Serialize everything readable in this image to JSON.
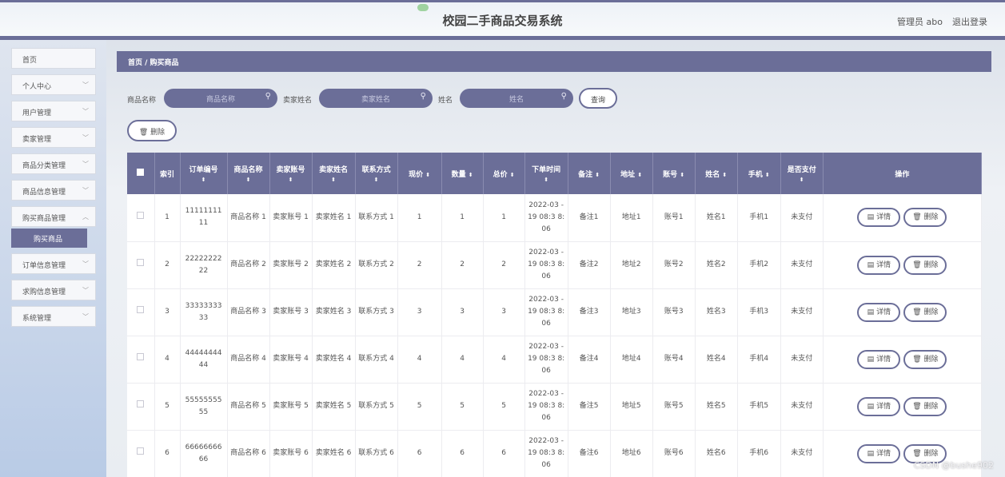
{
  "header": {
    "title": "校园二手商品交易系统",
    "user": "管理员 abo",
    "logout": "退出登录"
  },
  "sidebar": {
    "items": [
      {
        "label": "首页"
      },
      {
        "label": "个人中心"
      },
      {
        "label": "用户管理"
      },
      {
        "label": "卖家管理"
      },
      {
        "label": "商品分类管理"
      },
      {
        "label": "商品信息管理"
      },
      {
        "label": "购买商品管理"
      },
      {
        "label": "订单信息管理"
      },
      {
        "label": "求购信息管理"
      },
      {
        "label": "系统管理"
      }
    ],
    "active_sub": "购买商品"
  },
  "breadcrumb": {
    "text": "首页 / 购买商品"
  },
  "search": {
    "field1_label": "商品名称",
    "field1_placeholder": "商品名称",
    "field2_label": "卖家姓名",
    "field2_placeholder": "卖家姓名",
    "field3_label": "姓名",
    "field3_placeholder": "姓名",
    "query_label": "查询"
  },
  "toolbar": {
    "delete_label": "删除"
  },
  "table": {
    "headers": [
      "索引",
      "订单编号",
      "商品名称",
      "卖家账号",
      "卖家姓名",
      "联系方式",
      "现价",
      "数量",
      "总价",
      "下单时间",
      "备注",
      "地址",
      "账号",
      "姓名",
      "手机",
      "是否支付",
      "操作"
    ],
    "detail_label": "详情",
    "delete_label": "删除",
    "rows": [
      {
        "idx": "1",
        "order": "11111111 11",
        "goods": "商品名称 1",
        "seller_acc": "卖家账号 1",
        "seller_name": "卖家姓名 1",
        "contact": "联系方式 1",
        "price": "1",
        "qty": "1",
        "total": "1",
        "time": "2022-03 -19 08:3 8:06",
        "note": "备注1",
        "addr": "地址1",
        "acc": "账号1",
        "name": "姓名1",
        "phone": "手机1",
        "paid": "未支付"
      },
      {
        "idx": "2",
        "order": "22222222 22",
        "goods": "商品名称 2",
        "seller_acc": "卖家账号 2",
        "seller_name": "卖家姓名 2",
        "contact": "联系方式 2",
        "price": "2",
        "qty": "2",
        "total": "2",
        "time": "2022-03 -19 08:3 8:06",
        "note": "备注2",
        "addr": "地址2",
        "acc": "账号2",
        "name": "姓名2",
        "phone": "手机2",
        "paid": "未支付"
      },
      {
        "idx": "3",
        "order": "33333333 33",
        "goods": "商品名称 3",
        "seller_acc": "卖家账号 3",
        "seller_name": "卖家姓名 3",
        "contact": "联系方式 3",
        "price": "3",
        "qty": "3",
        "total": "3",
        "time": "2022-03 -19 08:3 8:06",
        "note": "备注3",
        "addr": "地址3",
        "acc": "账号3",
        "name": "姓名3",
        "phone": "手机3",
        "paid": "未支付"
      },
      {
        "idx": "4",
        "order": "44444444 44",
        "goods": "商品名称 4",
        "seller_acc": "卖家账号 4",
        "seller_name": "卖家姓名 4",
        "contact": "联系方式 4",
        "price": "4",
        "qty": "4",
        "total": "4",
        "time": "2022-03 -19 08:3 8:06",
        "note": "备注4",
        "addr": "地址4",
        "acc": "账号4",
        "name": "姓名4",
        "phone": "手机4",
        "paid": "未支付"
      },
      {
        "idx": "5",
        "order": "55555555 55",
        "goods": "商品名称 5",
        "seller_acc": "卖家账号 5",
        "seller_name": "卖家姓名 5",
        "contact": "联系方式 5",
        "price": "5",
        "qty": "5",
        "total": "5",
        "time": "2022-03 -19 08:3 8:06",
        "note": "备注5",
        "addr": "地址5",
        "acc": "账号5",
        "name": "姓名5",
        "phone": "手机5",
        "paid": "未支付"
      },
      {
        "idx": "6",
        "order": "66666666 66",
        "goods": "商品名称 6",
        "seller_acc": "卖家账号 6",
        "seller_name": "卖家姓名 6",
        "contact": "联系方式 6",
        "price": "6",
        "qty": "6",
        "total": "6",
        "time": "2022-03 -19 08:3 8:06",
        "note": "备注6",
        "addr": "地址6",
        "acc": "账号6",
        "name": "姓名6",
        "phone": "手机6",
        "paid": "未支付"
      }
    ]
  },
  "watermark": "CSDN @bushe902",
  "colors": {
    "accent": "#6b6e98",
    "background": "#eef1f5"
  }
}
